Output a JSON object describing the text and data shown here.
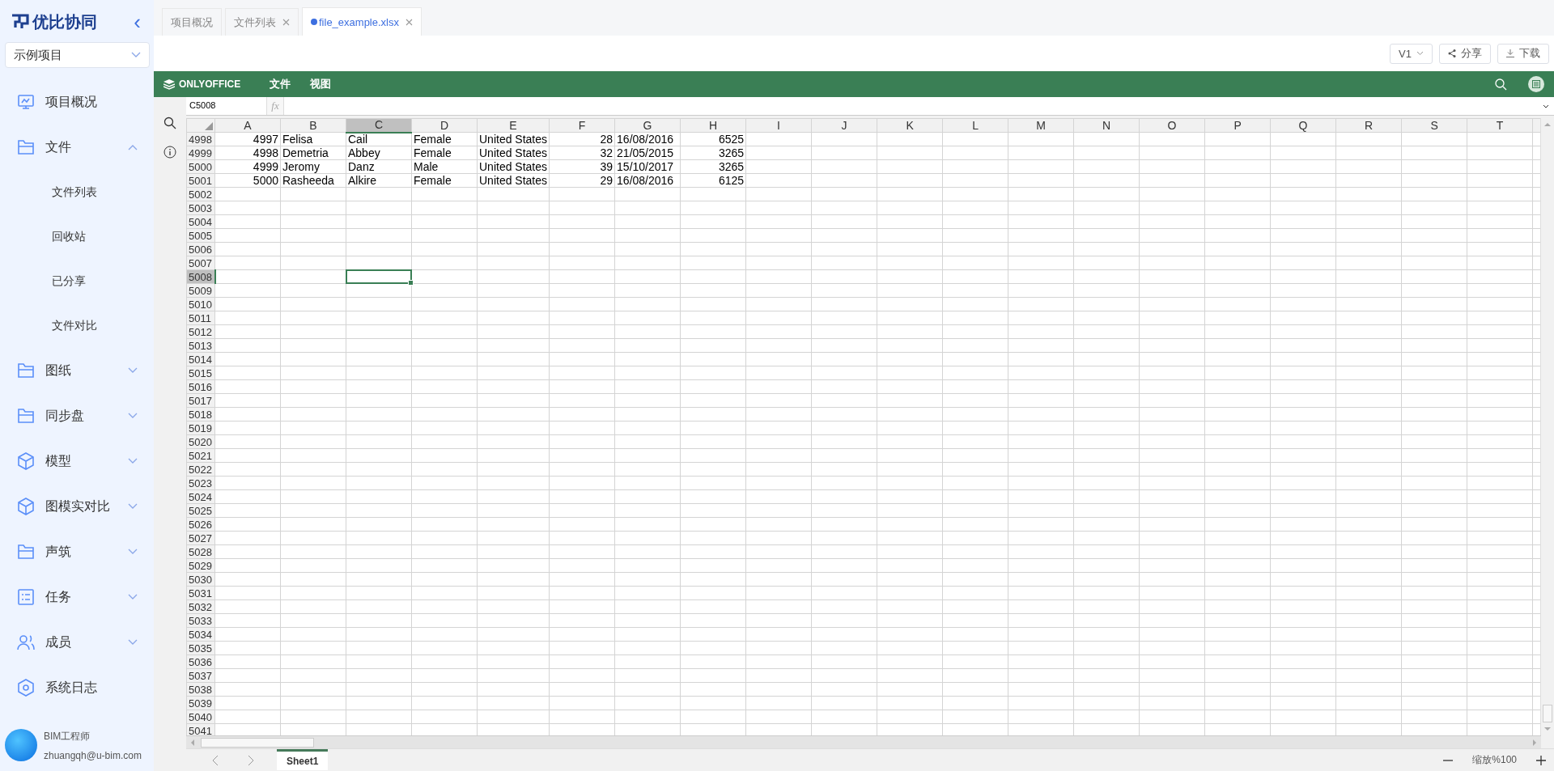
{
  "sidebar": {
    "logo": "优比协同",
    "collapse_icon": "‹",
    "project": "示例项目",
    "items": [
      {
        "label": "项目概况",
        "kind": "link"
      },
      {
        "label": "文件",
        "kind": "group",
        "expanded": true,
        "children": [
          {
            "label": "文件列表"
          },
          {
            "label": "回收站"
          },
          {
            "label": "已分享"
          },
          {
            "label": "文件对比"
          }
        ]
      },
      {
        "label": "图纸",
        "kind": "group",
        "expanded": false
      },
      {
        "label": "同步盘",
        "kind": "group",
        "expanded": false
      },
      {
        "label": "模型",
        "kind": "group",
        "expanded": false
      },
      {
        "label": "图模实对比",
        "kind": "group",
        "expanded": false
      },
      {
        "label": "声筑",
        "kind": "group",
        "expanded": false
      },
      {
        "label": "任务",
        "kind": "group",
        "expanded": false
      },
      {
        "label": "成员",
        "kind": "group",
        "expanded": false
      },
      {
        "label": "系统日志",
        "kind": "link"
      }
    ],
    "user": {
      "role": "BIM工程师",
      "email": "zhuangqh@u-bim.com"
    }
  },
  "tabs": [
    {
      "label": "项目概况",
      "selected": false,
      "closable": false,
      "modified": false
    },
    {
      "label": "文件列表",
      "selected": false,
      "closable": true,
      "modified": false
    },
    {
      "label": "file_example.xlsx",
      "selected": true,
      "closable": true,
      "modified": true
    }
  ],
  "toolbar": {
    "version": "V1",
    "share": "分享",
    "download": "下载"
  },
  "editor": {
    "brand": "ONLYOFFICE",
    "menu": [
      "文件",
      "视图"
    ],
    "name_box": "C5008",
    "function_label": "fx",
    "columns": [
      {
        "label": "A",
        "selected": false,
        "kind": "number"
      },
      {
        "label": "B",
        "selected": false,
        "kind": "text"
      },
      {
        "label": "C",
        "selected": true,
        "kind": "text"
      },
      {
        "label": "D",
        "selected": false,
        "kind": "text"
      },
      {
        "label": "E",
        "selected": false,
        "kind": "text"
      },
      {
        "label": "F",
        "selected": false,
        "kind": "number"
      },
      {
        "label": "G",
        "selected": false,
        "kind": "text"
      },
      {
        "label": "H",
        "selected": false,
        "kind": "number"
      },
      {
        "label": "I",
        "selected": false
      },
      {
        "label": "J",
        "selected": false
      },
      {
        "label": "K",
        "selected": false
      },
      {
        "label": "L",
        "selected": false
      },
      {
        "label": "M",
        "selected": false
      },
      {
        "label": "N",
        "selected": false
      },
      {
        "label": "O",
        "selected": false
      },
      {
        "label": "P",
        "selected": false
      },
      {
        "label": "Q",
        "selected": false
      },
      {
        "label": "R",
        "selected": false
      },
      {
        "label": "S",
        "selected": false
      },
      {
        "label": "T",
        "selected": false
      }
    ],
    "rows": [
      {
        "header": "4998",
        "selected": false,
        "cells": [
          "4997",
          "Felisa",
          "Cail",
          "Female",
          "United States",
          "28",
          "16/08/2016",
          "6525"
        ]
      },
      {
        "header": "4999",
        "selected": false,
        "cells": [
          "4998",
          "Demetria",
          "Abbey",
          "Female",
          "United States",
          "32",
          "21/05/2015",
          "3265"
        ]
      },
      {
        "header": "5000",
        "selected": false,
        "cells": [
          "4999",
          "Jeromy",
          "Danz",
          "Male",
          "United States",
          "39",
          "15/10/2017",
          "3265"
        ]
      },
      {
        "header": "5001",
        "selected": false,
        "cells": [
          "5000",
          "Rasheeda",
          "Alkire",
          "Female",
          "United States",
          "29",
          "16/08/2016",
          "6125"
        ]
      },
      {
        "header": "5002",
        "selected": false
      },
      {
        "header": "5003",
        "selected": false
      },
      {
        "header": "5004",
        "selected": false
      },
      {
        "header": "5005",
        "selected": false
      },
      {
        "header": "5006",
        "selected": false
      },
      {
        "header": "5007",
        "selected": false
      },
      {
        "header": "5008",
        "selected": true
      },
      {
        "header": "5009",
        "selected": false
      },
      {
        "header": "5010",
        "selected": false
      },
      {
        "header": "5011",
        "selected": false
      },
      {
        "header": "5012",
        "selected": false
      },
      {
        "header": "5013",
        "selected": false
      },
      {
        "header": "5014",
        "selected": false
      },
      {
        "header": "5015",
        "selected": false
      },
      {
        "header": "5016",
        "selected": false
      },
      {
        "header": "5017",
        "selected": false
      },
      {
        "header": "5018",
        "selected": false
      },
      {
        "header": "5019",
        "selected": false
      },
      {
        "header": "5020",
        "selected": false
      },
      {
        "header": "5021",
        "selected": false
      },
      {
        "header": "5022",
        "selected": false
      },
      {
        "header": "5023",
        "selected": false
      },
      {
        "header": "5024",
        "selected": false
      },
      {
        "header": "5025",
        "selected": false
      },
      {
        "header": "5026",
        "selected": false
      },
      {
        "header": "5027",
        "selected": false
      },
      {
        "header": "5028",
        "selected": false
      },
      {
        "header": "5029",
        "selected": false
      },
      {
        "header": "5030",
        "selected": false
      },
      {
        "header": "5031",
        "selected": false
      },
      {
        "header": "5032",
        "selected": false
      },
      {
        "header": "5033",
        "selected": false
      },
      {
        "header": "5034",
        "selected": false
      },
      {
        "header": "5035",
        "selected": false
      },
      {
        "header": "5036",
        "selected": false
      },
      {
        "header": "5037",
        "selected": false
      },
      {
        "header": "5038",
        "selected": false
      },
      {
        "header": "5039",
        "selected": false
      },
      {
        "header": "5040",
        "selected": false
      },
      {
        "header": "5041",
        "selected": false
      }
    ],
    "sheets": [
      {
        "label": "Sheet1",
        "selected": true
      }
    ],
    "zoom": "缩放%100"
  }
}
